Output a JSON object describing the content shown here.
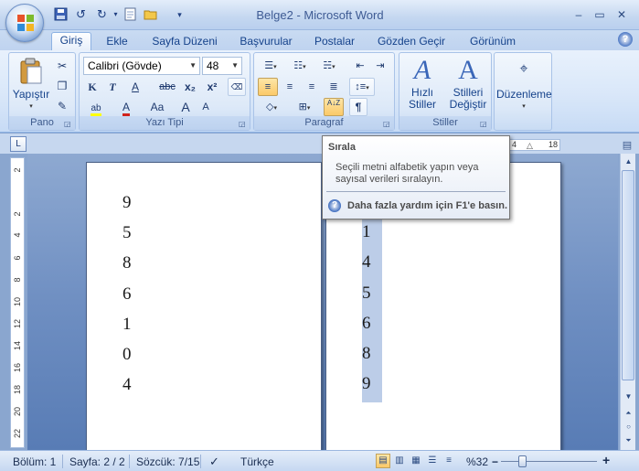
{
  "window": {
    "title": "Belge2 - Microsoft Word",
    "minimize_glyph": "–",
    "maximize_glyph": "▭",
    "close_glyph": "✕"
  },
  "quick_access": {
    "save_icon": "floppy-disk-icon",
    "undo_glyph": "↺",
    "redo_glyph": "↻",
    "customize_glyph": "▾"
  },
  "tabs": [
    {
      "label": "Giriş",
      "active": true
    },
    {
      "label": "Ekle"
    },
    {
      "label": "Sayfa Düzeni"
    },
    {
      "label": "Başvurular"
    },
    {
      "label": "Postalar"
    },
    {
      "label": "Gözden Geçir"
    },
    {
      "label": "Görünüm"
    }
  ],
  "ribbon": {
    "pano": {
      "label": "Pano",
      "paste_label": "Yapıştır",
      "cut_glyph": "✂",
      "copy_glyph": "❐",
      "painter_glyph": "✎"
    },
    "yazi_tipi": {
      "label": "Yazı Tipi",
      "font_name": "Calibri (Gövde)",
      "font_size": "48",
      "bold": "K",
      "italic": "T",
      "underline": "A",
      "strike": "abc",
      "subscript": "x₂",
      "superscript": "x²",
      "highlight": "ab",
      "font_color": "A",
      "change_case": "Aa",
      "grow": "A",
      "shrink": "A"
    },
    "paragraf": {
      "label": "Paragraf",
      "sort_glyph": "A↓Z",
      "pilcrow": "¶"
    },
    "stiller": {
      "label": "Stiller",
      "quick_styles": "Hızlı Stiller",
      "change_styles": "Stilleri Değiştir"
    },
    "duzenleme": {
      "label": "Düzenleme"
    }
  },
  "ruler": {
    "toggle_glyph": "L",
    "h_labels": [
      "4",
      "18"
    ],
    "v_labels": [
      "2",
      "2",
      "4",
      "6",
      "8",
      "10",
      "12",
      "14",
      "16",
      "18",
      "20",
      "22"
    ]
  },
  "document": {
    "page1_numbers": [
      "9",
      "5",
      "8",
      "6",
      "1",
      "0",
      "4"
    ],
    "page2_numbers": [
      "1",
      "4",
      "5",
      "6",
      "8",
      "9"
    ]
  },
  "tooltip": {
    "title": "Sırala",
    "body": "Seçili metni alfabetik yapın veya sayısal verileri sıralayın.",
    "help": "Daha fazla yardım için F1'e basın."
  },
  "statusbar": {
    "section": "Bölüm: 1",
    "page": "Sayfa: 2 / 2",
    "words": "Sözcük: 7/15",
    "language": "Türkçe",
    "zoom": "%32",
    "zoom_minus": "−",
    "zoom_plus": "+"
  },
  "colors": {
    "accent": "#15428b",
    "selection": "#bccde8",
    "ribbon_bg": "#dbe8f9"
  }
}
